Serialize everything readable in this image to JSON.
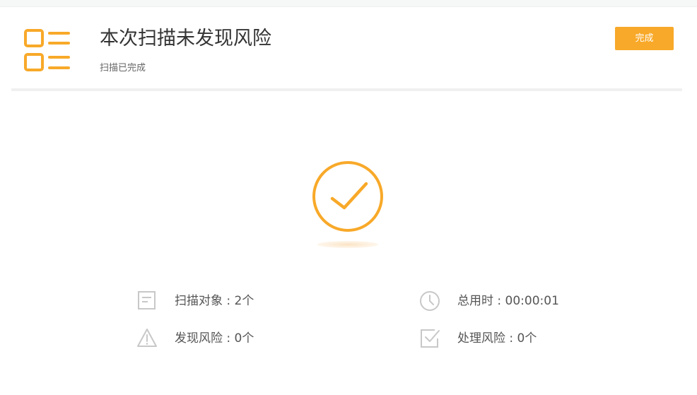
{
  "header": {
    "title": "本次扫描未发现风险",
    "subtitle": "扫描已完成",
    "done_label": "完成",
    "logo_icon": "list-icon"
  },
  "status": {
    "icon": "check-circle-icon"
  },
  "stats": {
    "scan_objects": {
      "label": "扫描对象 : 2个",
      "icon": "document-icon"
    },
    "total_time": {
      "label": "总用时 : 00:00:01",
      "icon": "clock-icon"
    },
    "risks_found": {
      "label": "发现风险 : 0个",
      "icon": "warning-icon"
    },
    "risks_handled": {
      "label": "处理风险 : 0个",
      "icon": "checkbox-icon"
    }
  },
  "colors": {
    "accent": "#f8a929",
    "icon_gray": "#c8c8c8",
    "text": "#555555"
  }
}
